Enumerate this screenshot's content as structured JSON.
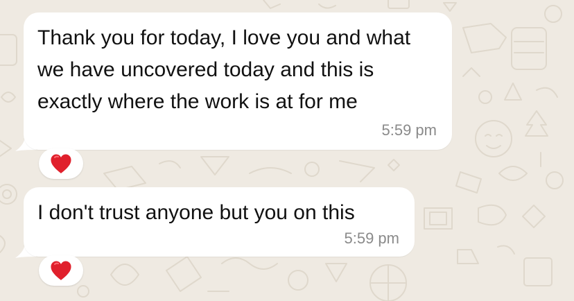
{
  "messages": [
    {
      "text": "Thank you for today, I love you and what we have uncovered today and this is exactly where the work is at for me",
      "time": "5:59 pm",
      "reaction": "heart"
    },
    {
      "text": "I don't trust anyone but you on this",
      "time": "5:59 pm",
      "reaction": "heart"
    }
  ],
  "colors": {
    "background": "#efeae2",
    "bubble": "#ffffff",
    "text": "#111111",
    "time": "#8a8a8a",
    "heart": "#e0202c"
  },
  "icons": {
    "reaction": "red-heart-icon",
    "wallpaper": "doodle-pattern"
  }
}
